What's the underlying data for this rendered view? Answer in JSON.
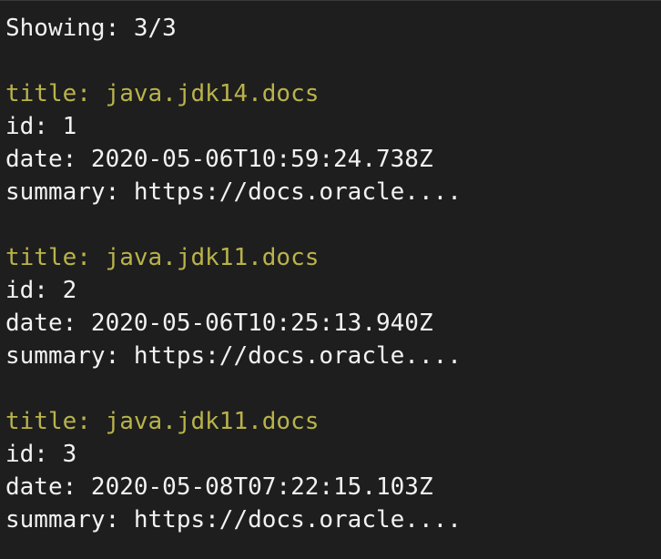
{
  "showing_line": "Showing: 3/3",
  "records": [
    {
      "title": "title: java.jdk14.docs",
      "id": "id: 1",
      "date": "date: 2020-05-06T10:59:24.738Z",
      "summary": "summary: https://docs.oracle...."
    },
    {
      "title": "title: java.jdk11.docs",
      "id": "id: 2",
      "date": "date: 2020-05-06T10:25:13.940Z",
      "summary": "summary: https://docs.oracle...."
    },
    {
      "title": "title: java.jdk11.docs",
      "id": "id: 3",
      "date": "date: 2020-05-08T07:22:15.103Z",
      "summary": "summary: https://docs.oracle...."
    }
  ],
  "colors": {
    "background": "#1e1e1e",
    "text": "#f2f2f2",
    "title": "#b9b34a"
  }
}
